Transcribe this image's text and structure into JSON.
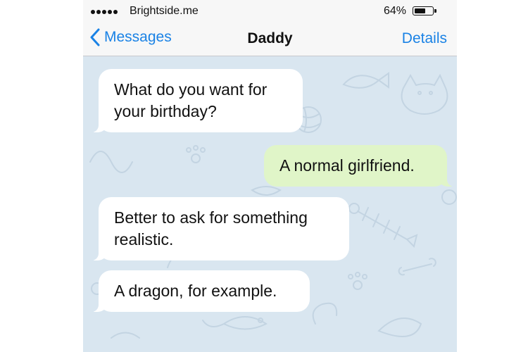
{
  "status_bar": {
    "carrier": "Brightside.me",
    "battery_percent": "64%",
    "battery_level": 0.64,
    "signal_icon": "signal-dots-icon",
    "battery_icon": "battery-icon"
  },
  "nav": {
    "back_label": "Messages",
    "title": "Daddy",
    "details_label": "Details",
    "back_icon": "chevron-left-icon"
  },
  "colors": {
    "accent": "#1a82e5",
    "chat_background": "#d9e6f0",
    "incoming_bubble": "#ffffff",
    "outgoing_bubble": "#e0f5c8"
  },
  "messages": [
    {
      "direction": "incoming",
      "text": "What do you want for\nyour birthday?"
    },
    {
      "direction": "outgoing",
      "text": "A normal girlfriend."
    },
    {
      "direction": "incoming",
      "text": "Better to ask for something\nrealistic."
    },
    {
      "direction": "incoming",
      "text": "A dragon, for example."
    }
  ]
}
